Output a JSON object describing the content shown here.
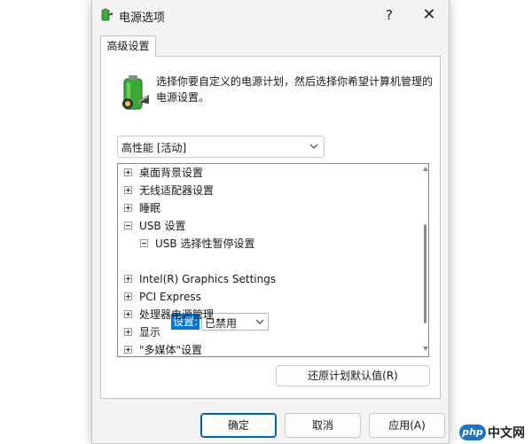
{
  "window": {
    "title": "电源选项",
    "help_glyph": "?",
    "close_glyph": "✕"
  },
  "tabs": [
    {
      "label": "高级设置"
    }
  ],
  "description": "选择你要自定义的电源计划，然后选择你希望计算机管理的电源设置。",
  "plan_dropdown": {
    "value": "高性能 [活动]"
  },
  "tree": {
    "items": [
      {
        "label": "桌面背景设置",
        "expander": "plus"
      },
      {
        "label": "无线适配器设置",
        "expander": "plus"
      },
      {
        "label": "睡眠",
        "expander": "plus"
      },
      {
        "label": "USB 设置",
        "expander": "minus"
      },
      {
        "label": "USB 选择性暂停设置",
        "expander": "minus"
      },
      {
        "label": "Intel(R) Graphics Settings",
        "expander": "plus"
      },
      {
        "label": "PCI Express",
        "expander": "plus"
      },
      {
        "label": "处理器电源管理",
        "expander": "plus"
      },
      {
        "label": "显示",
        "expander": "plus"
      },
      {
        "label": "\"多媒体\"设置",
        "expander": "plus"
      }
    ],
    "setting": {
      "label": "设置:",
      "value": "已禁用"
    }
  },
  "buttons": {
    "restore": "还原计划默认值(R)",
    "ok": "确定",
    "cancel": "取消",
    "apply": "应用(A)"
  },
  "watermark": {
    "logo_text": "php",
    "site_text": "中文网"
  },
  "colors": {
    "accent": "#0078d4",
    "battery_green": "#3aa935"
  }
}
